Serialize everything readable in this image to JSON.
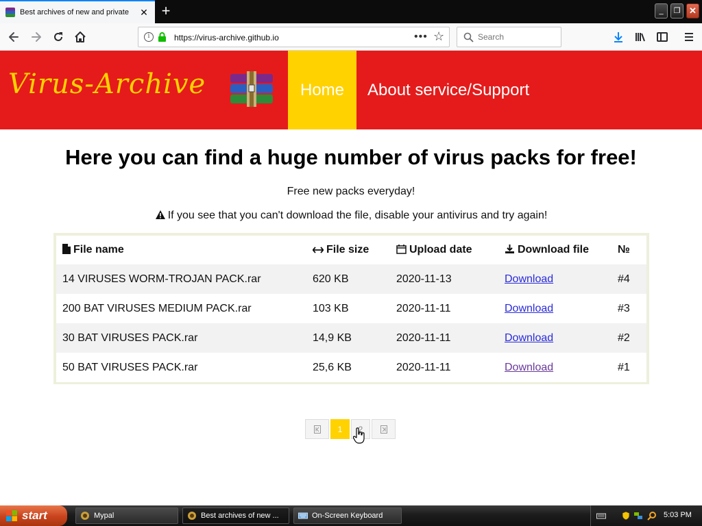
{
  "browser": {
    "tab_title": "Best archives of new and private",
    "tab_close": "✕",
    "new_tab": "+",
    "url": "https://virus-archive.github.io",
    "url_menu": "•••",
    "search_placeholder": "Search"
  },
  "site": {
    "logo_text": "Virus-Archive",
    "nav": {
      "home": "Home",
      "about": "About service/Support"
    },
    "headline": "Here you can find a huge number of virus packs for free!",
    "subline": "Free new packs everyday!",
    "warning": "If you see that you can't download the file, disable your antivirus and try again!"
  },
  "table": {
    "headers": {
      "name": "File name",
      "size": "File size",
      "date": "Upload date",
      "download": "Download file",
      "number": "№"
    },
    "rows": [
      {
        "name": "14 VIRUSES WORM-TROJAN PACK.rar",
        "size": "620 KB",
        "date": "2020-11-13",
        "download": "Download",
        "number": "#4"
      },
      {
        "name": "200 BAT VIRUSES MEDIUM PACK.rar",
        "size": "103 KB",
        "date": "2020-11-11",
        "download": "Download",
        "number": "#3"
      },
      {
        "name": "30 BAT VIRUSES PACK.rar",
        "size": "14,9 KB",
        "date": "2020-11-11",
        "download": "Download",
        "number": "#2"
      },
      {
        "name": "50 BAT VIRUSES PACK.rar",
        "size": "25,6 KB",
        "date": "2020-11-11",
        "download": "Download",
        "number": "#1"
      }
    ]
  },
  "pagination": {
    "pages": [
      "1",
      "2"
    ],
    "current": "1"
  },
  "taskbar": {
    "start_label": "start",
    "tasks": [
      "Mypal",
      "Best archives of new ...",
      "On-Screen Keyboard"
    ],
    "clock": "5:03 PM"
  },
  "colors": {
    "header_red": "#e51b1b",
    "accent_yellow": "#ffd200",
    "link_blue": "#2a2adb"
  }
}
